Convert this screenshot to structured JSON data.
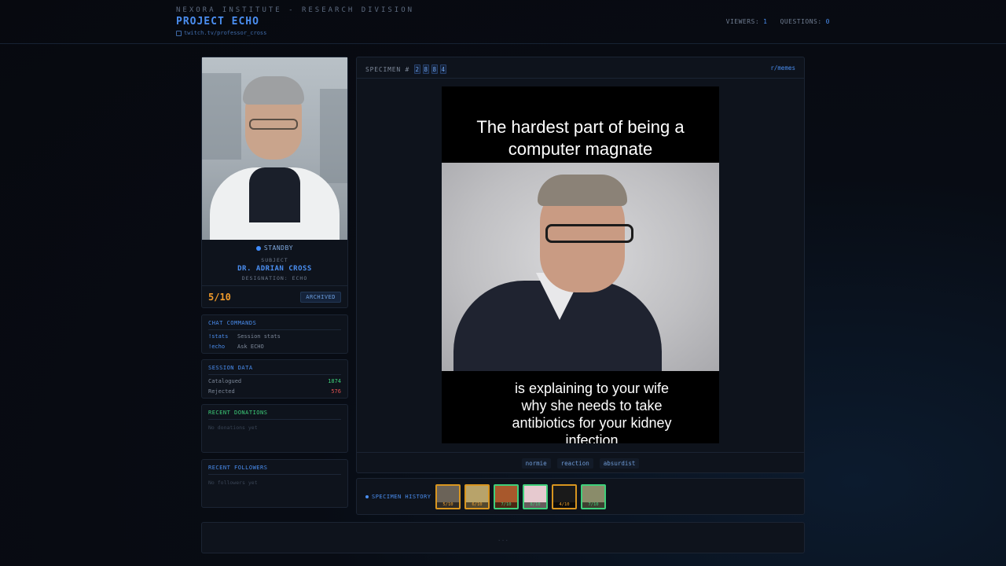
{
  "header": {
    "org": "NEXORA INSTITUTE - RESEARCH DIVISION",
    "project": "PROJECT ECHO",
    "channel": "twitch.tv/professor_cross",
    "viewers_label": "VIEWERS:",
    "viewers_value": "1",
    "questions_label": "QUESTIONS:",
    "questions_value": "0"
  },
  "profile": {
    "status": "STANDBY",
    "subject_label": "SUBJECT",
    "name": "DR. ADRIAN CROSS",
    "designation": "DESIGNATION: ECHO",
    "score": "5/10",
    "badge": "ARCHIVED"
  },
  "commands": {
    "title": "CHAT COMMANDS",
    "items": [
      {
        "cmd": "!stats",
        "desc": "Session stats"
      },
      {
        "cmd": "!echo",
        "desc": "Ask ECHO"
      }
    ]
  },
  "session": {
    "title": "SESSION DATA",
    "catalogued_label": "Catalogued",
    "catalogued_value": "1874",
    "rejected_label": "Rejected",
    "rejected_value": "576"
  },
  "donations": {
    "title": "RECENT DONATIONS",
    "empty": "No donations yet"
  },
  "followers": {
    "title": "RECENT FOLLOWERS",
    "empty": "No followers yet"
  },
  "specimen": {
    "label": "SPECIMEN #",
    "digits": [
      "2",
      "8",
      "8",
      "4"
    ],
    "source": "r/memes",
    "meme_top": "The hardest part of being a computer magnate",
    "meme_bottom": "is explaining to your wife why she needs to take antibiotics for your kidney infection",
    "tags": [
      "normie",
      "reaction",
      "absurdist"
    ]
  },
  "history": {
    "label": "SPECIMEN HISTORY",
    "items": [
      {
        "score": "5/10",
        "tone": "orange",
        "bg": "#6b6358"
      },
      {
        "score": "6/10",
        "tone": "orange",
        "bg": "#b8a36a"
      },
      {
        "score": "7/10",
        "tone": "green",
        "bg": "#a8582c"
      },
      {
        "score": "8/10",
        "tone": "green",
        "bg": "#e6c9cf"
      },
      {
        "score": "4/10",
        "tone": "orange",
        "bg": "#1a1a1a"
      },
      {
        "score": "7/10",
        "tone": "green",
        "bg": "#8a8c6a"
      }
    ]
  },
  "footer": {
    "dots": "..."
  }
}
